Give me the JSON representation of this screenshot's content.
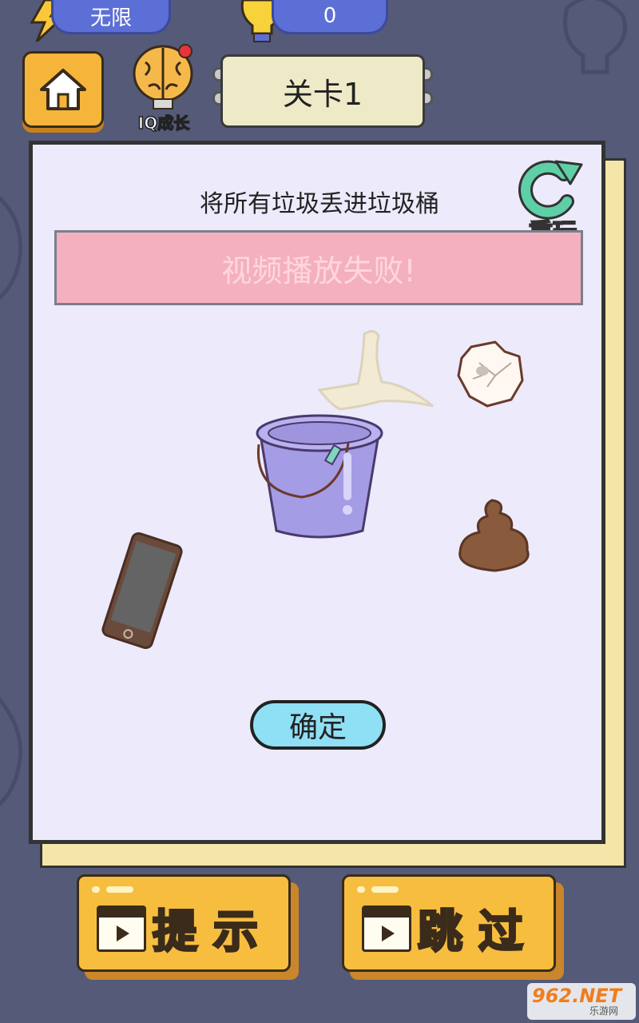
{
  "status": {
    "energy_label": "无限",
    "hint_count": "0"
  },
  "header": {
    "iq_growth_label": "IQ成长",
    "level_label": "关卡1"
  },
  "puzzle": {
    "instruction": "将所有垃圾丢进垃圾桶",
    "replay_label": "重玩",
    "video_failed_text": "视频播放失败!",
    "confirm_label": "确定",
    "items": [
      "banana-peel",
      "crumpled-paper",
      "bucket",
      "poop",
      "phone"
    ]
  },
  "actions": {
    "hint_label": "提示",
    "skip_label": "跳过"
  },
  "watermark": {
    "brand": "962.NET",
    "sub": "乐游网"
  },
  "colors": {
    "background": "#545a78",
    "panel": "#eceafb",
    "accent_orange": "#f7bd3f",
    "confirm_blue": "#8fdff5",
    "error_pink": "#f4b0bf"
  }
}
